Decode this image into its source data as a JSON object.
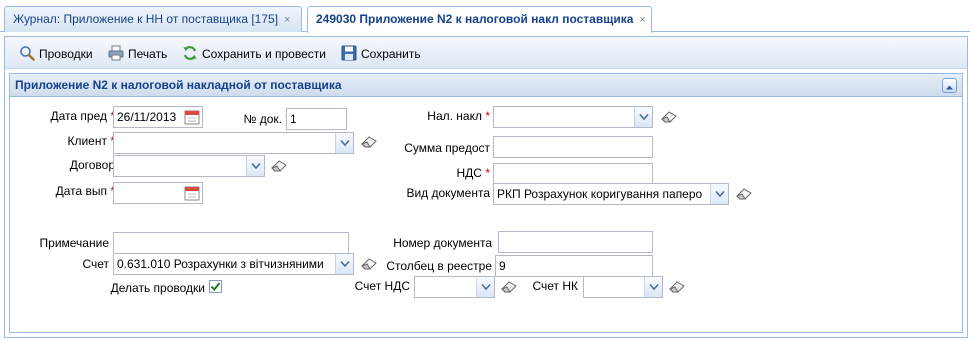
{
  "tabs": [
    {
      "label": "Журнал: Приложение к НН от поставщика [175]",
      "close": "×"
    },
    {
      "label": "249030 Приложение N2 к налоговой накл поставщика",
      "close": "×"
    }
  ],
  "toolbar": {
    "postings": "Проводки",
    "print": "Печать",
    "save_post": "Сохранить и провести",
    "save": "Сохранить"
  },
  "form": {
    "title": "Приложение N2 к налоговой накладной от поставщика",
    "req": "*",
    "date_pred_label": "Дата пред",
    "date_pred_value": "26/11/2013",
    "doc_no_label": "№ док.",
    "doc_no_value": "1",
    "nal_nakl_label": "Нал. накл",
    "nal_nakl_value": "",
    "client_label": "Клиент",
    "client_value": "",
    "sum_label": "Сумма предост",
    "sum_value": "",
    "contract_label": "Договор",
    "contract_value": "",
    "nds_label": "НДС",
    "nds_value": "",
    "date_vyp_label": "Дата вып",
    "date_vyp_value": "",
    "doc_type_label": "Вид документа",
    "doc_type_value": "РКП Розрахунок коригування паперо",
    "note_label": "Примечание",
    "note_value": "",
    "doc_number_label": "Номер документа",
    "doc_number_value": "",
    "account_label": "Счет",
    "account_value": "0.631.010 Розрахунки з вітчизняними",
    "column_label": "Столбец в реестре",
    "column_value": "9",
    "make_postings_label": "Делать проводки",
    "make_postings_checked": true,
    "nds_account_label": "Счет НДС",
    "nds_account_value": "",
    "nk_account_label": "Счет НК",
    "nk_account_value": ""
  }
}
